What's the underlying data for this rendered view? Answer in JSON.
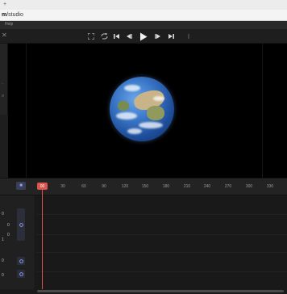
{
  "browser": {
    "chrome_glyph": "+",
    "url_host": "m",
    "url_path": "/studio"
  },
  "app": {
    "menu_label": "Help"
  },
  "toolbar": {
    "icons": [
      "fullscreen-icon",
      "loop-icon",
      "skip-start-icon",
      "step-back-icon",
      "play-icon",
      "step-forward-icon",
      "skip-end-icon",
      "more-icon"
    ]
  },
  "side_panel": {
    "marks": [
      "..",
      "o"
    ]
  },
  "timeline": {
    "current_frame": "00",
    "ticks": [
      "30",
      "60",
      "90",
      "120",
      "150",
      "180",
      "210",
      "240",
      "270",
      "300",
      "330"
    ],
    "accent": "#d9534f",
    "keyframe_accent": "#8fa0ff"
  },
  "tracks": {
    "labels": [
      "0",
      "0",
      "0",
      "1",
      "0",
      "0"
    ]
  },
  "canvas": {
    "subject": "earth"
  }
}
